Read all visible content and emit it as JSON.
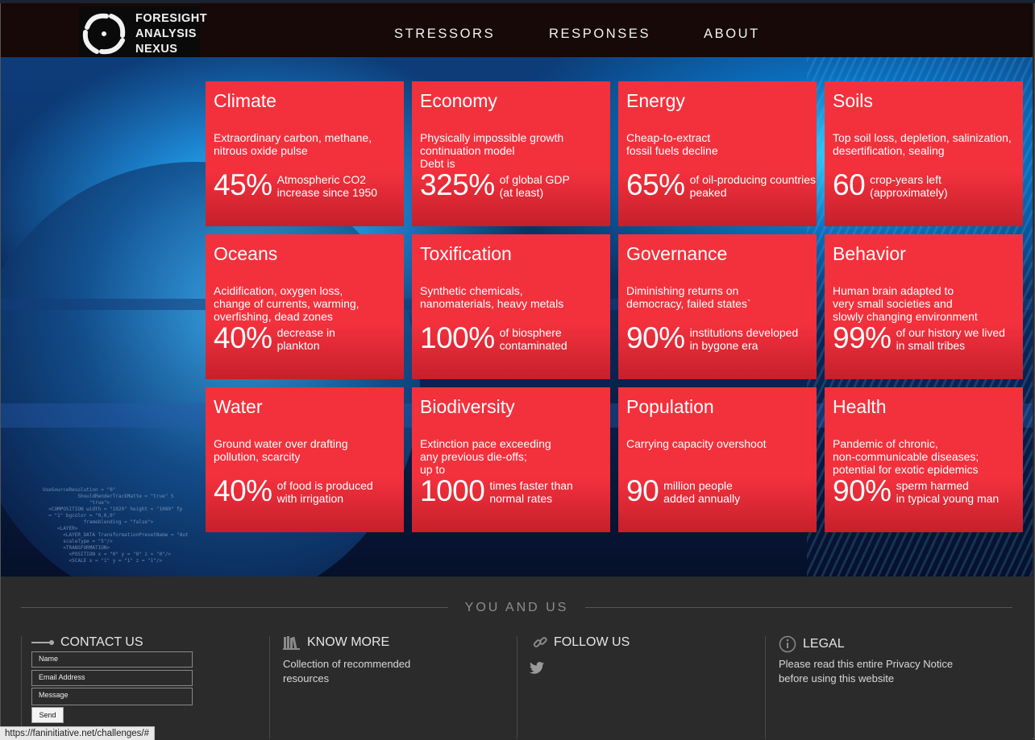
{
  "brand": {
    "line1": "FORESIGHT",
    "line2": "ANALYSIS",
    "line3": "NEXUS"
  },
  "nav": {
    "stressors": "STRESSORS",
    "responses": "RESPONSES",
    "about": "ABOUT"
  },
  "cards": [
    {
      "title": "Climate",
      "desc": "Extraordinary carbon, methane,\nnitrous oxide pulse",
      "num": "45%",
      "note": "Atmospheric CO2\nincrease since 1950"
    },
    {
      "title": "Economy",
      "desc": "Physically impossible growth\ncontinuation model\nDebt is",
      "num": "325%",
      "note": "of global GDP\n(at least)"
    },
    {
      "title": "Energy",
      "desc": "Cheap-to-extract\nfossil fuels decline",
      "num": "65%",
      "note": "of oil-producing countries\npeaked"
    },
    {
      "title": "Soils",
      "desc": "Top soil loss, depletion, salinization,\ndesertification, sealing",
      "num": "60",
      "note": "crop-years left\n(approximately)"
    },
    {
      "title": "Oceans",
      "desc": "Acidification, oxygen loss,\nchange of currents, warming,\noverfishing, dead zones",
      "num": "40%",
      "note": "decrease in\nplankton"
    },
    {
      "title": "Toxification",
      "desc": "Synthetic chemicals,\nnanomaterials, heavy metals",
      "num": "100%",
      "note": "of biosphere\ncontaminated"
    },
    {
      "title": "Governance",
      "desc": "Diminishing returns on\ndemocracy, failed states`",
      "num": "90%",
      "note": "institutions developed\nin bygone era"
    },
    {
      "title": "Behavior",
      "desc": "Human brain adapted to\nvery small societies and\nslowly changing environment",
      "num": "99%",
      "note": "of our history we lived\nin small tribes"
    },
    {
      "title": "Water",
      "desc": "Ground water over drafting\npollution, scarcity",
      "num": "40%",
      "note": "of food is produced\nwith irrigation"
    },
    {
      "title": "Biodiversity",
      "desc": "Extinction pace exceeding\nany previous die-offs;\nup to",
      "num": "1000",
      "note": "times faster than\nnormal rates"
    },
    {
      "title": "Population",
      "desc": "Carrying capacity overshoot",
      "num": "90",
      "note": "million people\nadded annually"
    },
    {
      "title": "Health",
      "desc": "Pandemic of chronic,\nnon-communicable diseases;\npotential for exotic epidemics",
      "num": "90%",
      "note": "sperm harmed\nin typical young man"
    }
  ],
  "footer": {
    "heading": "YOU AND US",
    "contact": {
      "title": "CONTACT US",
      "name_placeholder": "Name",
      "email_placeholder": "Email Address",
      "message_placeholder": "Message",
      "send": "Send"
    },
    "know": {
      "title": "KNOW MORE",
      "text": "Collection of recommended\nresources"
    },
    "follow": {
      "title": "FOLLOW US"
    },
    "legal": {
      "title": "LEGAL",
      "text": "Please read this entire Privacy Notice\nbefore using this website"
    }
  },
  "status_url": "https://faninitiative.net/challenges/#",
  "icons": [
    "logo-mark-icon",
    "contact-line-icon",
    "books-icon",
    "link-icon",
    "twitter-icon",
    "info-icon"
  ],
  "colors": {
    "card_red": "#f3313d",
    "header_bg": "#160907",
    "footer_bg": "#2b2b2b"
  }
}
